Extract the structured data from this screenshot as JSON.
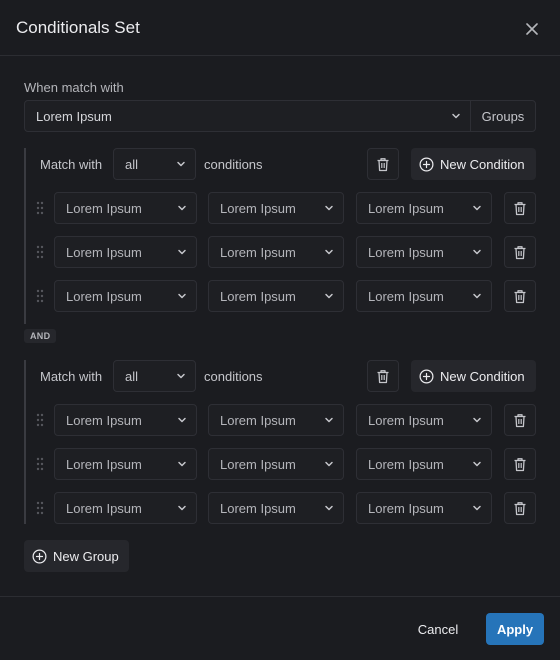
{
  "header": {
    "title": "Conditionals Set"
  },
  "match": {
    "label": "When match with",
    "value": "Lorem Ipsum",
    "groups_label": "Groups"
  },
  "groups": [
    {
      "match_label": "Match with",
      "match_value": "all",
      "conditions_label": "conditions",
      "new_condition_label": "New Condition",
      "rows": [
        {
          "field": "Lorem Ipsum",
          "operator": "Lorem Ipsum",
          "value": "Lorem Ipsum"
        },
        {
          "field": "Lorem Ipsum",
          "operator": "Lorem Ipsum",
          "value": "Lorem Ipsum"
        },
        {
          "field": "Lorem Ipsum",
          "operator": "Lorem Ipsum",
          "value": "Lorem Ipsum"
        }
      ]
    },
    {
      "match_label": "Match with",
      "match_value": "all",
      "conditions_label": "conditions",
      "new_condition_label": "New Condition",
      "rows": [
        {
          "field": "Lorem Ipsum",
          "operator": "Lorem Ipsum",
          "value": "Lorem Ipsum"
        },
        {
          "field": "Lorem Ipsum",
          "operator": "Lorem Ipsum",
          "value": "Lorem Ipsum"
        },
        {
          "field": "Lorem Ipsum",
          "operator": "Lorem Ipsum",
          "value": "Lorem Ipsum"
        }
      ]
    }
  ],
  "and_label": "AND",
  "new_group_label": "New Group",
  "footer": {
    "cancel_label": "Cancel",
    "apply_label": "Apply"
  },
  "colors": {
    "background": "#1b1c20",
    "accent": "#2674b9",
    "border": "#2e2f35"
  },
  "icons": {
    "close": "close-icon",
    "chevron": "chevron-down-icon",
    "trash": "trash-icon",
    "plus": "plus-circle-icon",
    "drag": "drag-handle-icon"
  }
}
